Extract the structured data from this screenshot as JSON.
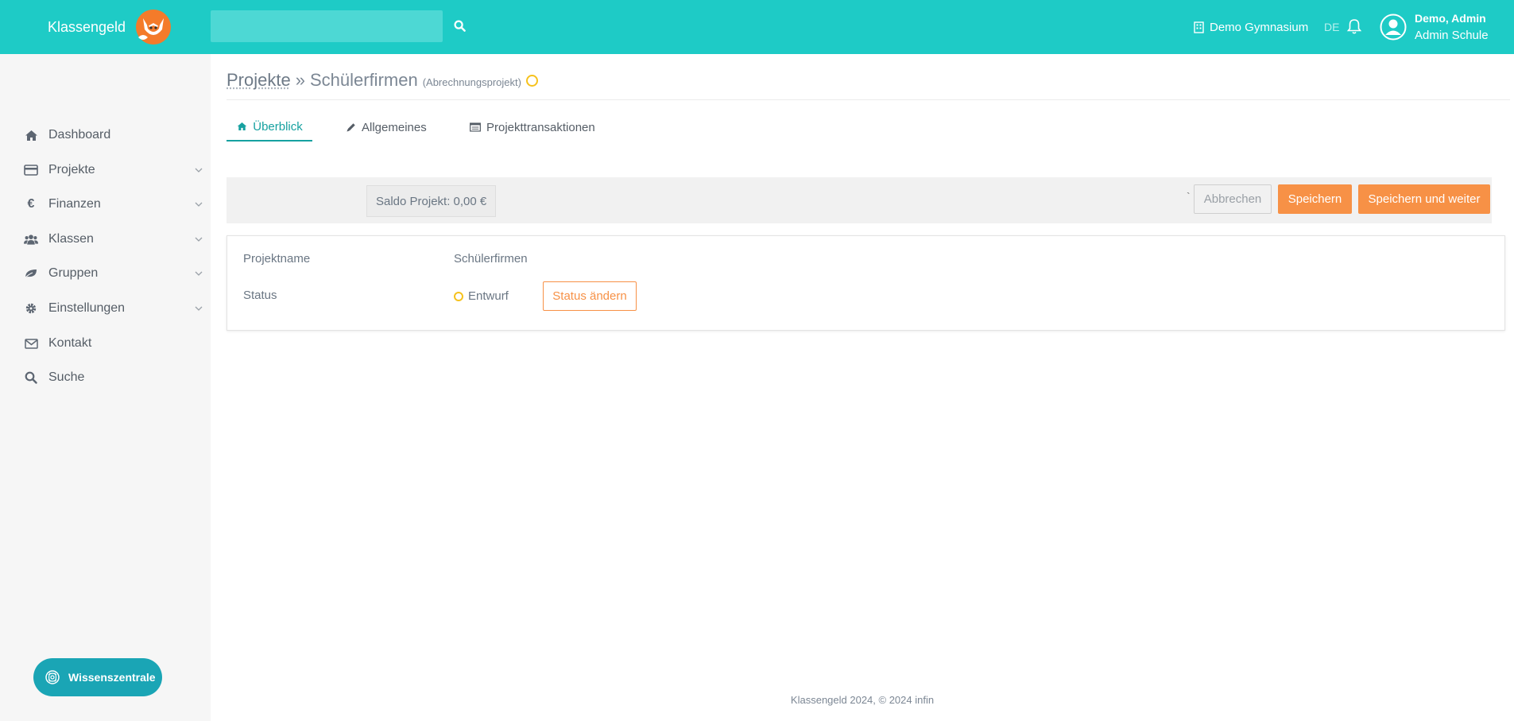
{
  "header": {
    "brand": "Klassengeld",
    "search_placeholder": "",
    "school": "Demo Gymnasium",
    "language": "DE",
    "user_name": "Demo, Admin",
    "user_role": "Admin Schule",
    "bg_color": "#1ecbc6"
  },
  "sidebar": {
    "items": [
      {
        "label": "Dashboard",
        "icon": "home-icon"
      },
      {
        "label": "Projekte",
        "icon": "credit-card-icon"
      },
      {
        "label": "Finanzen",
        "icon": "euro-icon"
      },
      {
        "label": "Klassen",
        "icon": "users-icon"
      },
      {
        "label": "Gruppen",
        "icon": "leaf-icon"
      },
      {
        "label": "Einstellungen",
        "icon": "gear-icon"
      },
      {
        "label": "Kontakt",
        "icon": "envelope-icon"
      },
      {
        "label": "Suche",
        "icon": "search-icon"
      }
    ],
    "help_button": "Wissenszentrale"
  },
  "page": {
    "breadcrumb_link": "Projekte",
    "breadcrumb_sep": "»",
    "breadcrumb_current": "Schülerfirmen",
    "breadcrumb_type": "(Abrechnungsprojekt)"
  },
  "tabs": [
    {
      "label": "Überblick",
      "icon": "home-icon"
    },
    {
      "label": "Allgemeines",
      "icon": "pencil-icon"
    },
    {
      "label": "Projekttransaktionen",
      "icon": "list-icon"
    }
  ],
  "actions": {
    "saldo": "Saldo Projekt: 0,00 €",
    "tick": "`",
    "cancel": "Abbrechen",
    "save": "Speichern",
    "save_continue": "Speichern und weiter",
    "accent_color": "#f79146"
  },
  "details": {
    "name_label": "Projektname",
    "name_value": "Schülerfirmen",
    "status_label": "Status",
    "status_value": "Entwurf",
    "status_button": "Status ändern"
  },
  "footer": "Klassengeld 2024, © 2024 infin"
}
